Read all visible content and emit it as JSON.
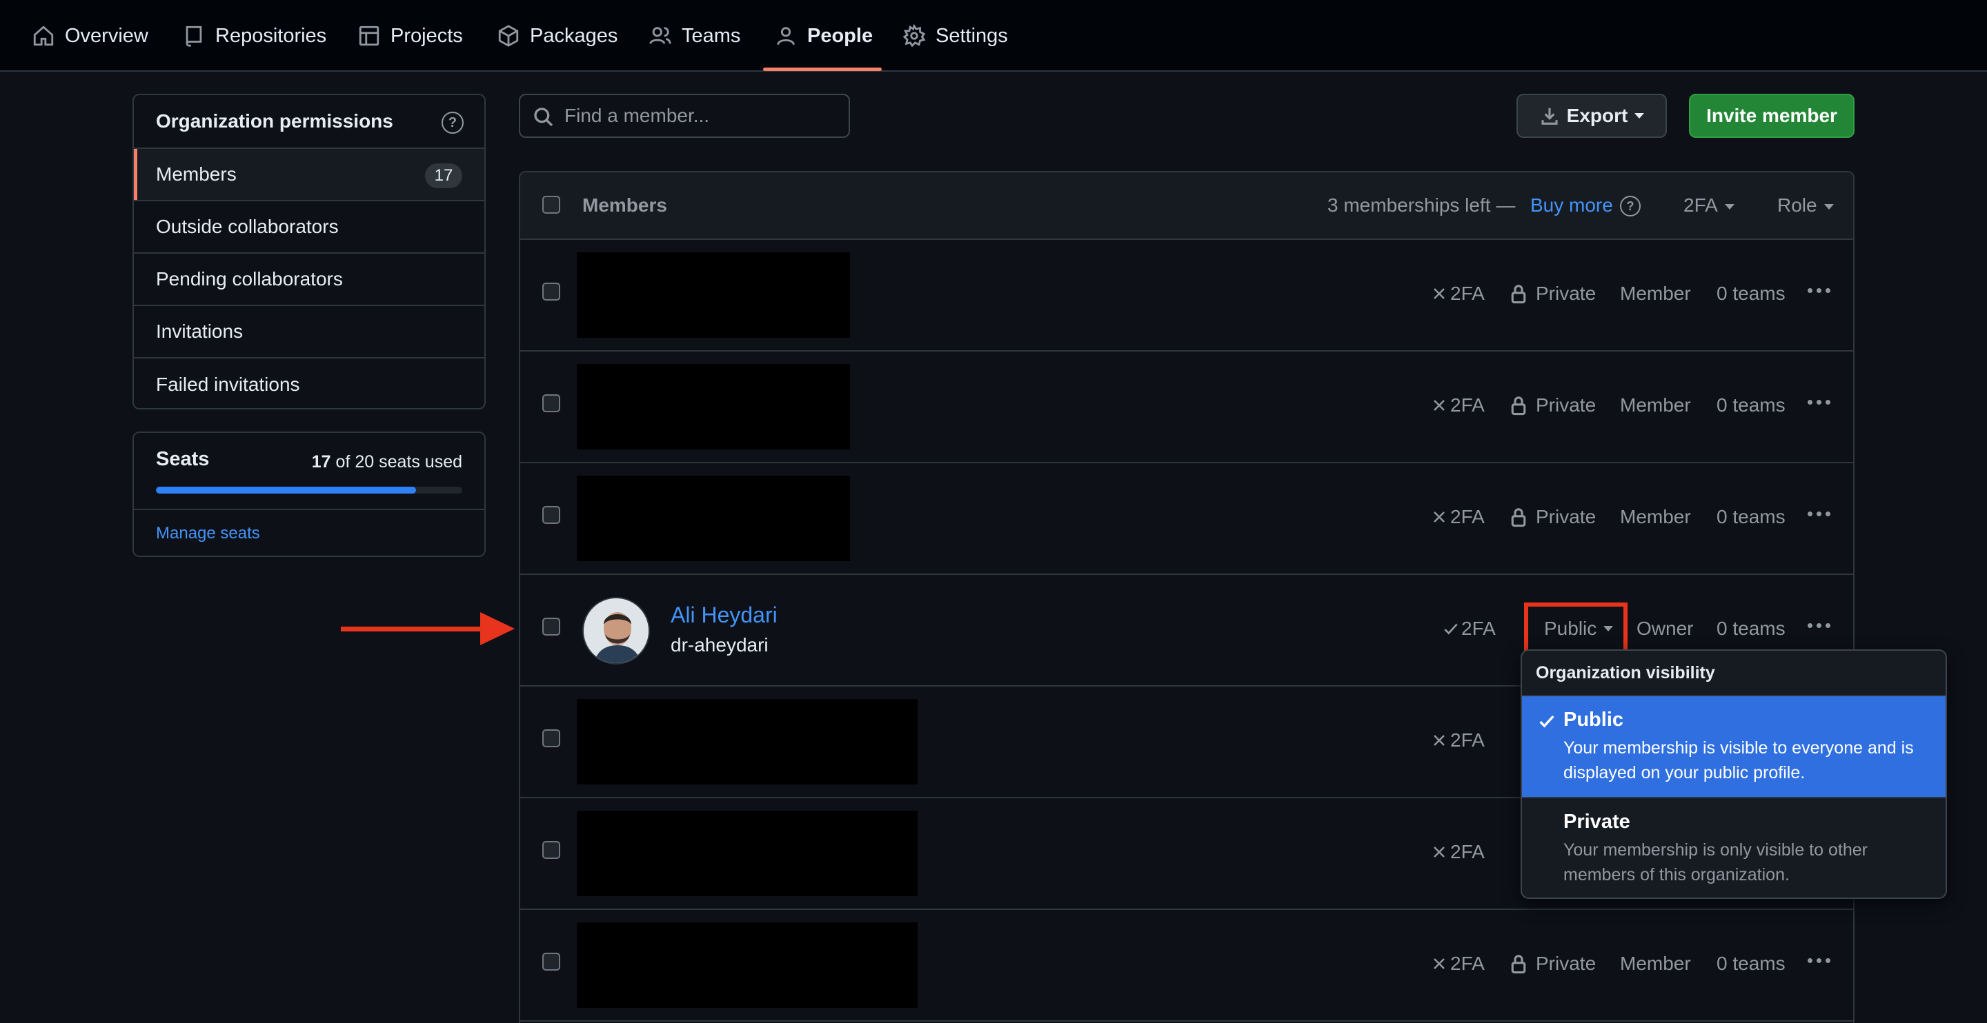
{
  "nav": {
    "items": [
      {
        "label": "Overview",
        "icon": "home-icon"
      },
      {
        "label": "Repositories",
        "icon": "repo-icon"
      },
      {
        "label": "Projects",
        "icon": "table-icon"
      },
      {
        "label": "Packages",
        "icon": "package-icon"
      },
      {
        "label": "Teams",
        "icon": "people-icon"
      },
      {
        "label": "People",
        "icon": "person-icon",
        "active": true
      },
      {
        "label": "Settings",
        "icon": "gear-icon"
      }
    ],
    "active_underline_color": "#f78166"
  },
  "sidebar": {
    "title": "Organization permissions",
    "items": [
      {
        "label": "Members",
        "count": "17",
        "active": true
      },
      {
        "label": "Outside collaborators"
      },
      {
        "label": "Pending collaborators"
      },
      {
        "label": "Invitations"
      },
      {
        "label": "Failed invitations"
      }
    ],
    "seats": {
      "title": "Seats",
      "used": "17",
      "of_text": " of 20 seats used",
      "progress_fraction": 0.85,
      "manage_label": "Manage seats"
    }
  },
  "search": {
    "placeholder": "Find a member..."
  },
  "actions": {
    "export_label": "Export",
    "invite_label": "Invite member"
  },
  "table": {
    "header": {
      "members": "Members",
      "memberships_left": "3 memberships left —",
      "buy_more": "Buy more",
      "twofa_filter": "2FA",
      "role_filter": "Role"
    },
    "rows": [
      {
        "redacted": true,
        "twofa": "2FA",
        "visibility": "Private",
        "role": "Member",
        "teams": "0 teams"
      },
      {
        "redacted": true,
        "twofa": "2FA",
        "visibility": "Private",
        "role": "Member",
        "teams": "0 teams"
      },
      {
        "redacted": true,
        "twofa": "2FA",
        "visibility": "Private",
        "role": "Member",
        "teams": "0 teams"
      },
      {
        "name": "Ali Heydari",
        "login": "dr-aheydari",
        "twofa": "2FA",
        "visibility": "Public",
        "role": "Owner",
        "teams": "0 teams"
      },
      {
        "redacted": true,
        "twofa": "2FA"
      },
      {
        "redacted": true,
        "twofa": "2FA"
      },
      {
        "redacted": true,
        "twofa": "2FA",
        "visibility": "Private",
        "role": "Member",
        "teams": "0 teams"
      }
    ]
  },
  "visibility_menu": {
    "title": "Organization visibility",
    "options": [
      {
        "label": "Public",
        "description": "Your membership is visible to everyone and is displayed on your public profile.",
        "selected": true
      },
      {
        "label": "Private",
        "description": "Your membership is only visible to other members of this organization."
      }
    ]
  },
  "colors": {
    "background": "#0d1117",
    "link": "#4493f8",
    "primary_button": "#238636",
    "selected_option": "#2f6fe0",
    "annotation": "#e8341c"
  }
}
